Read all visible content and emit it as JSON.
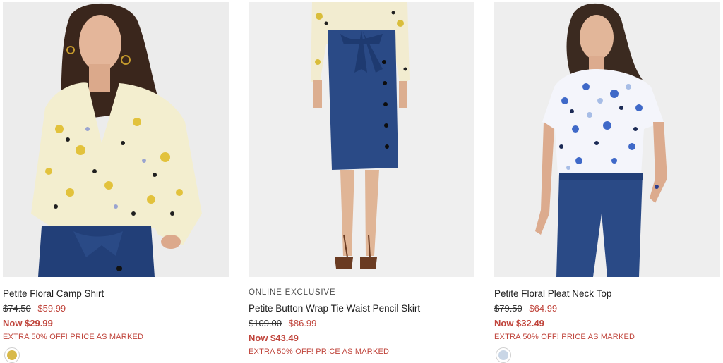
{
  "products": [
    {
      "image_alt": "Petite Floral Camp Shirt",
      "tag": "",
      "name": "Petite Floral Camp Shirt",
      "original_price": "$74.50",
      "sale_price": "$59.99",
      "now_price": "Now $29.99",
      "promo": "EXTRA 50% OFF! PRICE AS MARKED",
      "swatch_color": "#d8b94a"
    },
    {
      "image_alt": "Petite Button Wrap Tie Waist Pencil Skirt",
      "tag": "ONLINE EXCLUSIVE",
      "name": "Petite Button Wrap Tie Waist Pencil Skirt",
      "original_price": "$109.00",
      "sale_price": "$86.99",
      "now_price": "Now $43.49",
      "promo": "EXTRA 50% OFF! PRICE AS MARKED",
      "swatch_color": ""
    },
    {
      "image_alt": "Petite Floral Pleat Neck Top",
      "tag": "",
      "name": "Petite Floral Pleat Neck Top",
      "original_price": "$79.50",
      "sale_price": "$64.99",
      "now_price": "Now $32.49",
      "promo": "EXTRA 50% OFF! PRICE AS MARKED",
      "swatch_color": "#c9d6e6"
    }
  ],
  "colors": {
    "sale_red": "#c0453c",
    "image_bg": "#eeeeee",
    "denim": "#2a4a86"
  }
}
